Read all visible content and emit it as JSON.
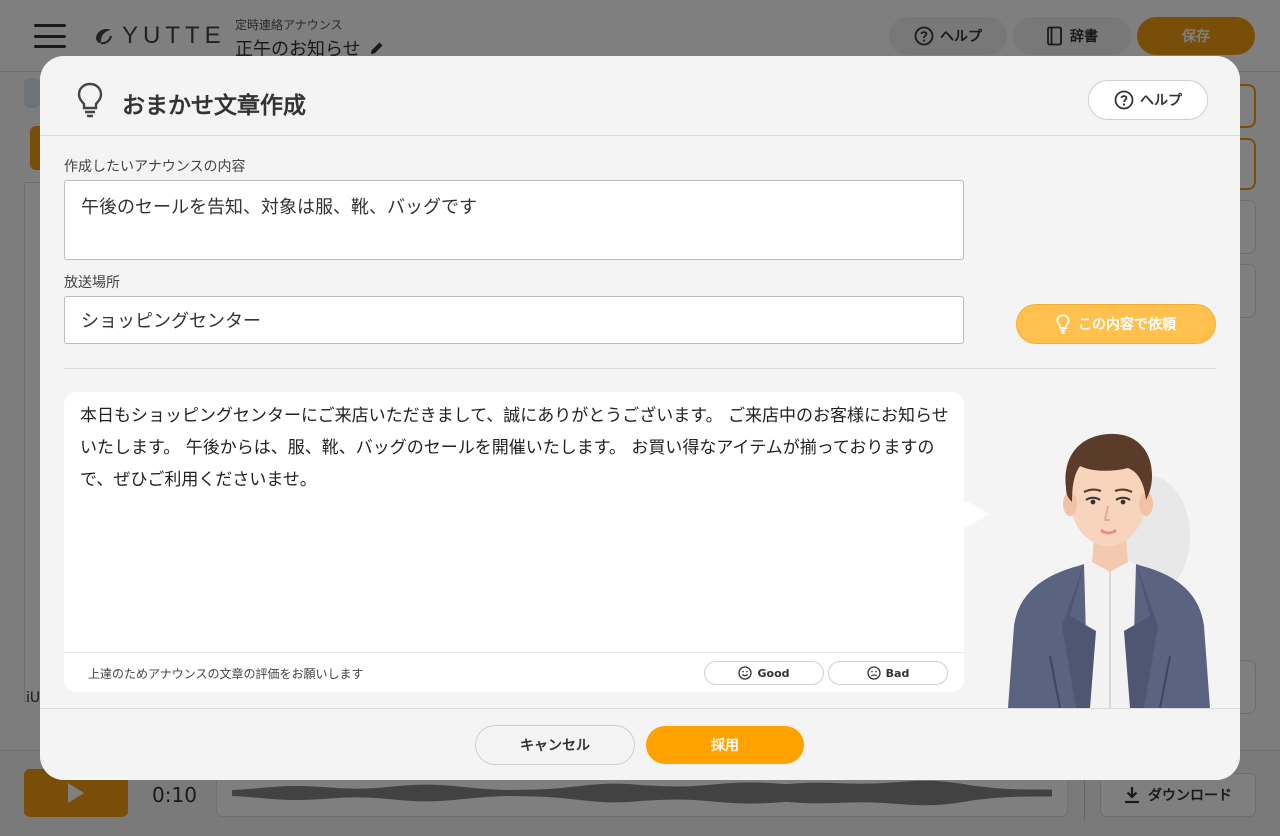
{
  "app": {
    "logo": "YUTTE",
    "breadcrumb_sub": "定時連絡アナウンス",
    "title": "正午のお知らせ",
    "help_label": "ヘルプ",
    "dictionary_label": "辞書",
    "save_label": "保存",
    "time": "0:10",
    "download_label": "ダウンロード",
    "fragment": "iU"
  },
  "modal": {
    "title": "おまかせ文章作成",
    "help_label": "ヘルプ",
    "content_label": "作成したいアナウンスの内容",
    "content_value": "午後のセールを告知、対象は服、靴、バッグです",
    "location_label": "放送場所",
    "location_value": "ショッピングセンター",
    "request_label": "この内容で依頼",
    "generated_text": "本日もショッピングセンターにご来店いただきまして、誠にありがとうございます。 ご来店中のお客様にお知らせいたします。 午後からは、服、靴、バッグのセールを開催いたします。 お買い得なアイテムが揃っておりますので、ぜひご利用くださいませ。",
    "rating_prompt": "上達のためアナウンスの文章の評価をお願いします",
    "good_label": "Good",
    "bad_label": "Bad",
    "cancel_label": "キャンセル",
    "adopt_label": "採用"
  },
  "colors": {
    "accent": "#ffa200",
    "accent_light": "#ffc04d",
    "overlay": "rgba(0,0,0,0.5)"
  },
  "icons": [
    "menu-icon",
    "logo-icon",
    "pencil-icon",
    "help-icon",
    "book-icon",
    "lightbulb-icon",
    "smile-icon",
    "frown-icon",
    "play-icon",
    "download-icon"
  ]
}
